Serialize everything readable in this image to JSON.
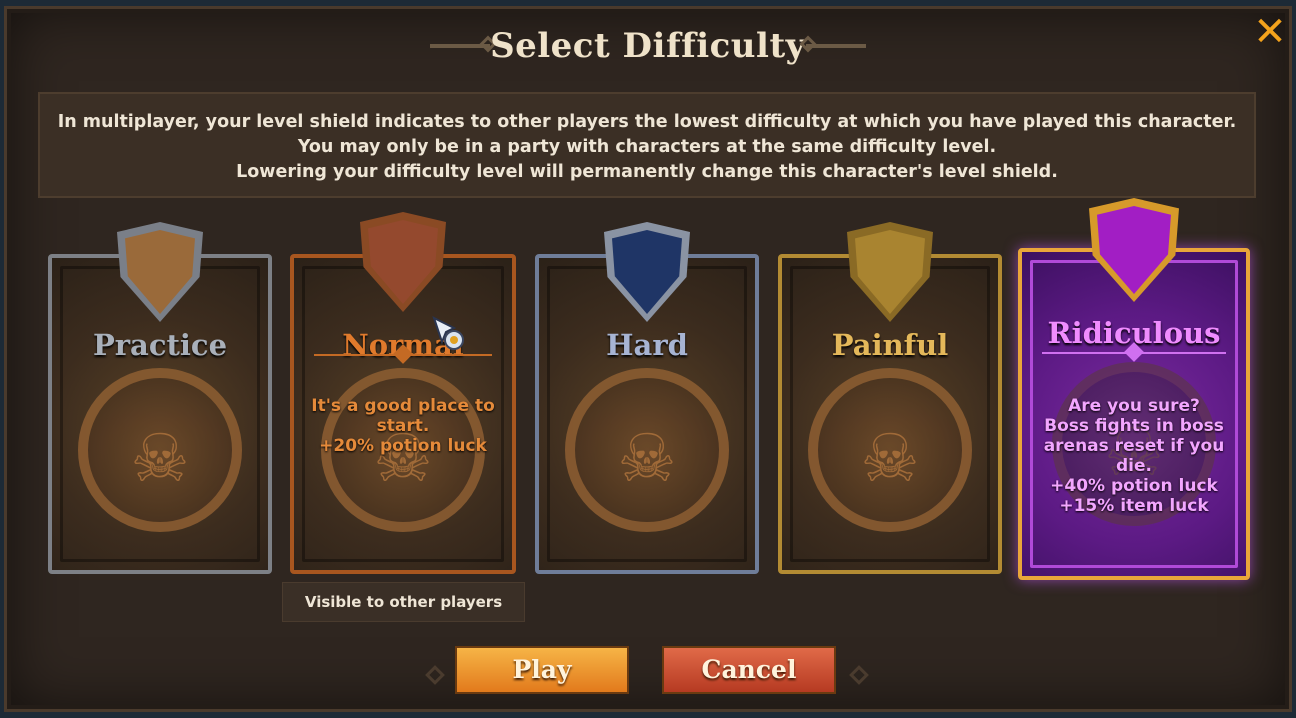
{
  "dialog": {
    "title": "Select Difficulty",
    "close_icon": "close-icon",
    "info_lines": [
      "In multiplayer, your level shield indicates to other players the lowest difficulty at which you have played this character.",
      "You may only be in a party with characters at the same difficulty level.",
      "Lowering your difficulty level will permanently change this character's level shield."
    ]
  },
  "difficulties": [
    {
      "name": "Practice",
      "selected": false,
      "description_lines": []
    },
    {
      "name": "Normal",
      "selected": false,
      "hovered": true,
      "description_lines": [
        "It's a good place to start.",
        "+20% potion luck"
      ]
    },
    {
      "name": "Hard",
      "selected": false,
      "description_lines": []
    },
    {
      "name": "Painful",
      "selected": false,
      "description_lines": []
    },
    {
      "name": "Ridiculous",
      "selected": true,
      "description_lines": [
        "Are you sure?",
        "Boss fights in boss arenas reset if you die.",
        "+40% potion luck",
        "+15% item luck"
      ]
    }
  ],
  "tooltip": {
    "text": "Visible to other players"
  },
  "buttons": {
    "play": "Play",
    "cancel": "Cancel"
  },
  "colors": {
    "accent": "#f3a21c",
    "practice": "#a9b0ba",
    "normal": "#e07a2c",
    "hard": "#a7b4d3",
    "painful": "#e4b85a",
    "ridiculous": "#f08cff"
  }
}
